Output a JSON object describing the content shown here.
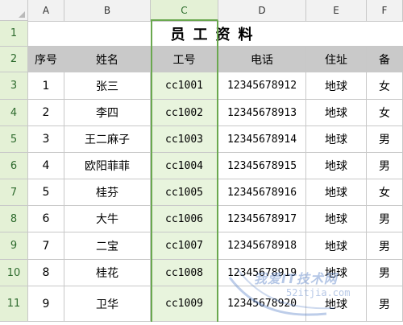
{
  "columns": [
    "A",
    "B",
    "C",
    "D",
    "E",
    "F"
  ],
  "selected_column": "C",
  "rows": [
    "1",
    "2",
    "3",
    "4",
    "5",
    "6",
    "7",
    "8",
    "9",
    "10",
    "11"
  ],
  "title": "员工资料",
  "headers": [
    "序号",
    "姓名",
    "工号",
    "电话",
    "住址",
    "备"
  ],
  "records": [
    [
      "1",
      "张三",
      "cc1001",
      "12345678912",
      "地球",
      "女"
    ],
    [
      "2",
      "李四",
      "cc1002",
      "12345678913",
      "地球",
      "女"
    ],
    [
      "3",
      "王二麻子",
      "cc1003",
      "12345678914",
      "地球",
      "男"
    ],
    [
      "4",
      "欧阳菲菲",
      "cc1004",
      "12345678915",
      "地球",
      "男"
    ],
    [
      "5",
      "桂芬",
      "cc1005",
      "12345678916",
      "地球",
      "女"
    ],
    [
      "6",
      "大牛",
      "cc1006",
      "12345678917",
      "地球",
      "男"
    ],
    [
      "7",
      "二宝",
      "cc1007",
      "12345678918",
      "地球",
      "男"
    ],
    [
      "8",
      "桂花",
      "cc1008",
      "12345678919",
      "地球",
      "男"
    ],
    [
      "9",
      "卫华",
      "cc1009",
      "12345678920",
      "地球",
      "男"
    ]
  ],
  "watermark": {
    "text": "我爱IT技术网",
    "url": "52itjia.com"
  },
  "colors": {
    "accent": "#6aa84f",
    "row_header_bg": "#e4f1d6",
    "header_row_bg": "#c9c9c9"
  }
}
